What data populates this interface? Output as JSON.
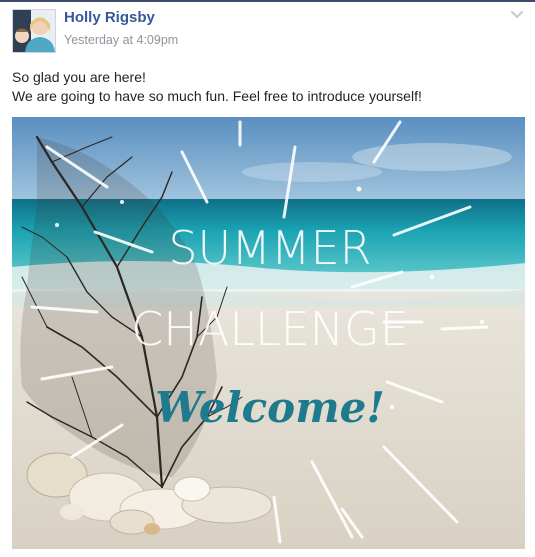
{
  "post": {
    "author": "Holly Rigsby",
    "timestamp": "Yesterday at 4:09pm",
    "message_lines": [
      "So glad you are here!",
      "We are going to have so much fun. Feel free to introduce yourself!"
    ],
    "image": {
      "line1": "SUMMER",
      "line2": "CHALLENGE",
      "line3": "Welcome!"
    }
  },
  "colors": {
    "author_link": "#365899",
    "timestamp": "#90949c",
    "welcome_text": "#1e7a8c",
    "sea": "#2bb3bd"
  },
  "icons": {
    "menu": "chevron-down-icon"
  }
}
